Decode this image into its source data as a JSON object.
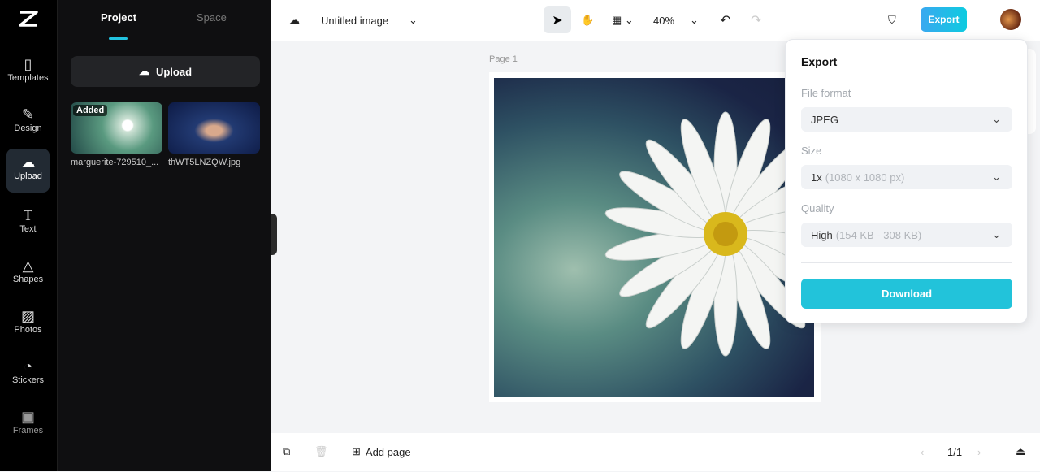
{
  "rail": {
    "items": [
      {
        "label": "Templates"
      },
      {
        "label": "Design"
      },
      {
        "label": "Upload"
      },
      {
        "label": "Text"
      },
      {
        "label": "Shapes"
      },
      {
        "label": "Photos"
      },
      {
        "label": "Stickers"
      },
      {
        "label": "Frames"
      }
    ]
  },
  "panel": {
    "tabs": [
      "Project",
      "Space"
    ],
    "upload_label": "Upload",
    "files": [
      {
        "name": "marguerite-729510_...",
        "badge": "Added"
      },
      {
        "name": "thWT5LNZQW.jpg"
      }
    ]
  },
  "topbar": {
    "title": "Untitled image",
    "zoom": "40%",
    "export_label": "Export"
  },
  "canvas": {
    "page_label": "Page 1"
  },
  "bottombar": {
    "add_page": "Add page",
    "page_counter": "1/1"
  },
  "export_popup": {
    "title": "Export",
    "file_format_label": "File format",
    "file_format": "JPEG",
    "size_label": "Size",
    "size": "1x",
    "size_detail": "(1080 x 1080 px)",
    "quality_label": "Quality",
    "quality": "High",
    "quality_detail": "(154 KB - 308 KB)",
    "download_label": "Download"
  },
  "colors": {
    "accent": "#22c3da",
    "rail_bg": "#000000",
    "panel_bg": "#0f0f11"
  }
}
